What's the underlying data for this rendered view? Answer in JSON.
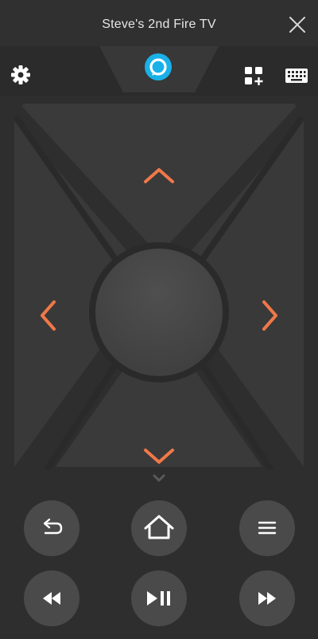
{
  "header": {
    "title": "Steve's 2nd Fire TV"
  },
  "icons": {
    "close": "close-icon",
    "settings": "gear-icon",
    "alexa": "alexa-icon",
    "apps": "apps-add-icon",
    "keyboard": "keyboard-icon",
    "back": "back-arrow-icon",
    "home": "home-icon",
    "menu": "hamburger-menu-icon",
    "rewind": "rewind-icon",
    "play_pause": "play-pause-icon",
    "fast_forward": "fast-forward-icon"
  },
  "colors": {
    "accent": "#f07848",
    "alexa": "#1ab0e8",
    "background": "#2e2e2e",
    "button": "#4a4a4a"
  }
}
